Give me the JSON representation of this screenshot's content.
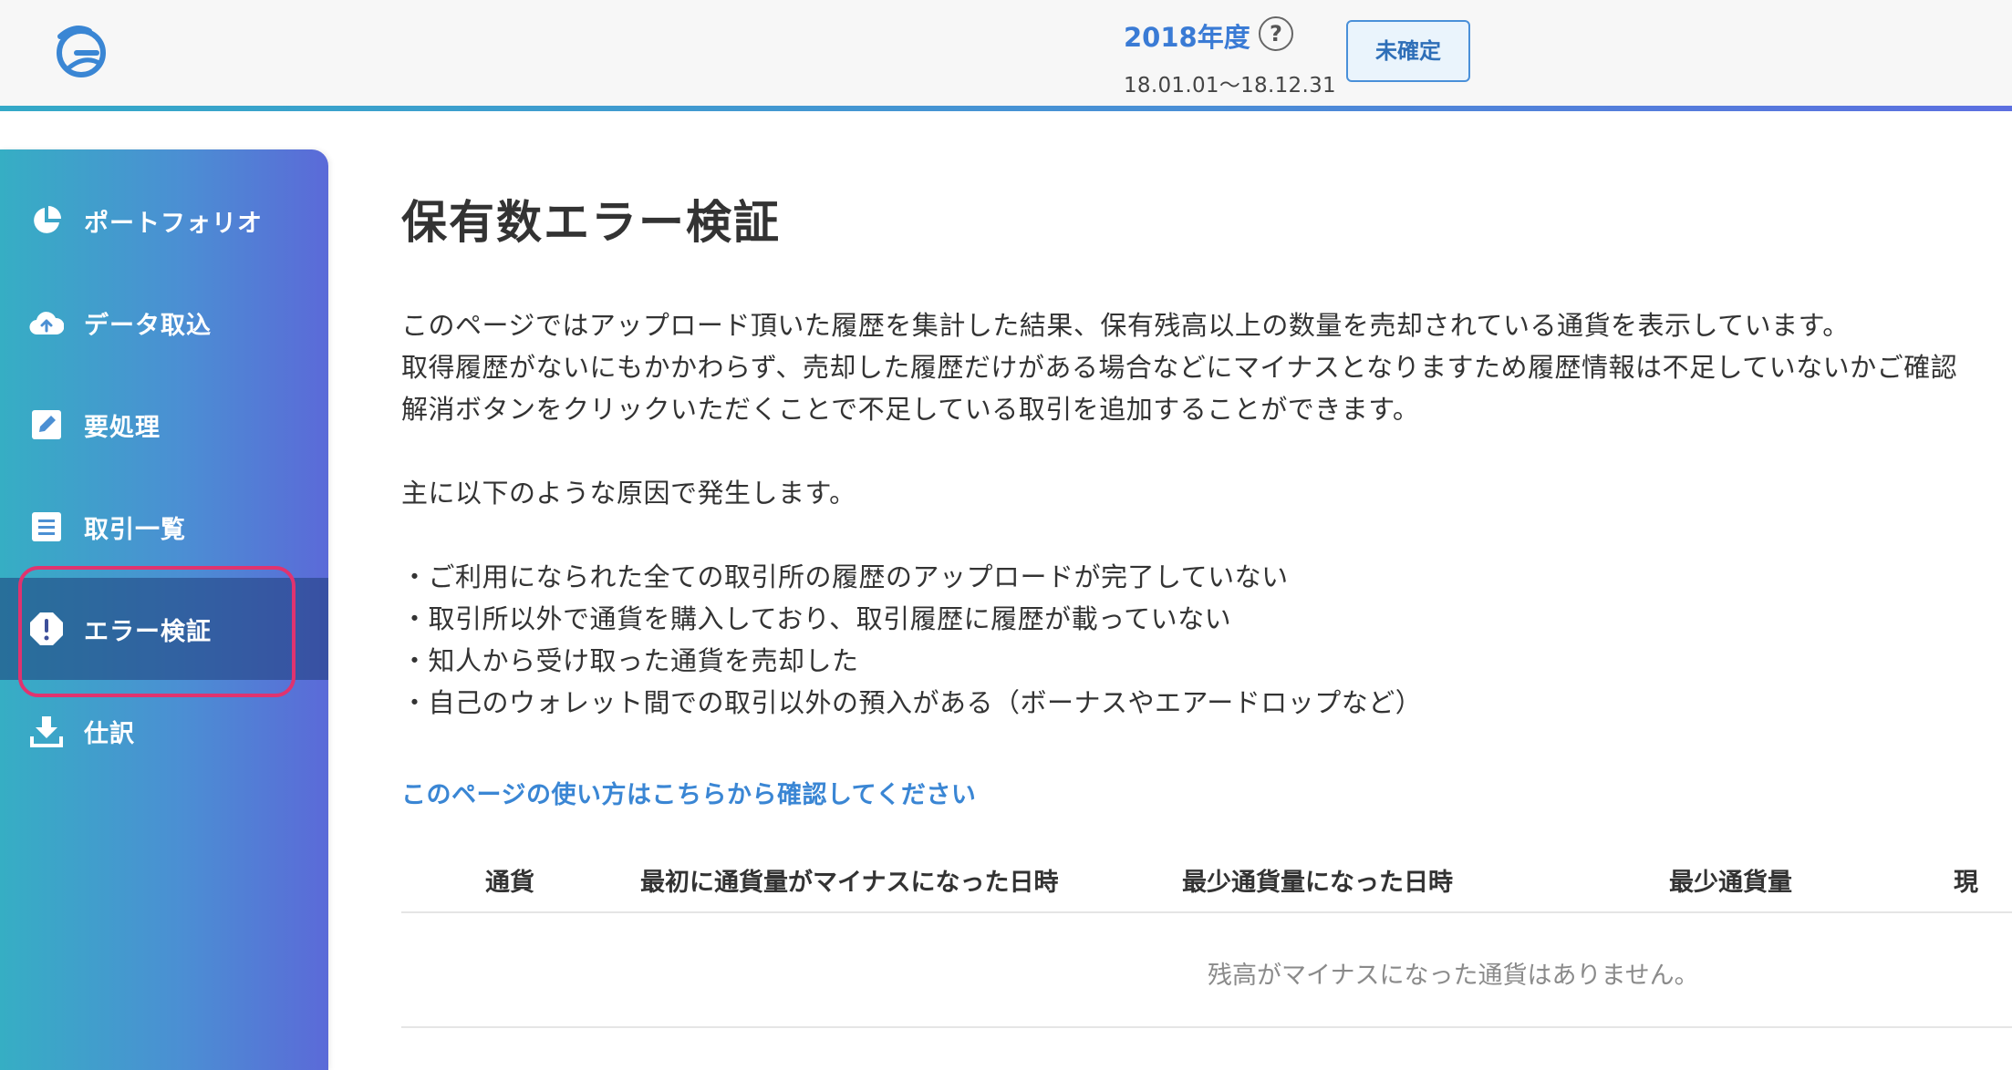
{
  "header": {
    "fiscal_year": "2018年度",
    "help_symbol": "?",
    "date_range": "18.01.01〜18.12.31",
    "status_button": "未確定",
    "logo_icon": "app-logo-icon"
  },
  "sidebar": {
    "items": [
      {
        "label": "ポートフォリオ",
        "icon": "pie-chart-icon",
        "active": false
      },
      {
        "label": "データ取込",
        "icon": "cloud-upload-icon",
        "active": false
      },
      {
        "label": "要処理",
        "icon": "edit-icon",
        "active": false
      },
      {
        "label": "取引一覧",
        "icon": "list-icon",
        "active": false
      },
      {
        "label": "エラー検証",
        "icon": "alert-octagon-icon",
        "active": true
      },
      {
        "label": "仕訳",
        "icon": "download-icon",
        "active": false
      }
    ]
  },
  "main": {
    "title": "保有数エラー検証",
    "description": [
      "このページではアップロード頂いた履歴を集計した結果、保有残高以上の数量を売却されている通貨を表示しています。",
      "取得履歴がないにもかかわらず、売却した履歴だけがある場合などにマイナスとなりますため履歴情報は不足していないかご確認",
      "解消ボタンをクリックいただくことで不足している取引を追加することができます。"
    ],
    "causes_intro": "主に以下のような原因で発生します。",
    "causes": [
      "・ご利用になられた全ての取引所の履歴のアップロードが完了していない",
      "・取引所以外で通貨を購入しており、取引履歴に履歴が載っていない",
      "・知人から受け取った通貨を売却した",
      "・自己のウォレット間での取引以外の預入がある（ボーナスやエアードロップなど）"
    ],
    "help_link": "このページの使い方はこちらから確認してください",
    "table": {
      "headers": [
        "通貨",
        "最初に通貨量がマイナスになった日時",
        "最少通貨量になった日時",
        "最少通貨量",
        "現"
      ],
      "empty_message": "残高がマイナスになった通貨はありません。"
    }
  },
  "colors": {
    "accent": "#3a86d4",
    "highlight": "#e0336f",
    "sidebar_start": "#36aec4",
    "sidebar_end": "#5b6ad8"
  }
}
